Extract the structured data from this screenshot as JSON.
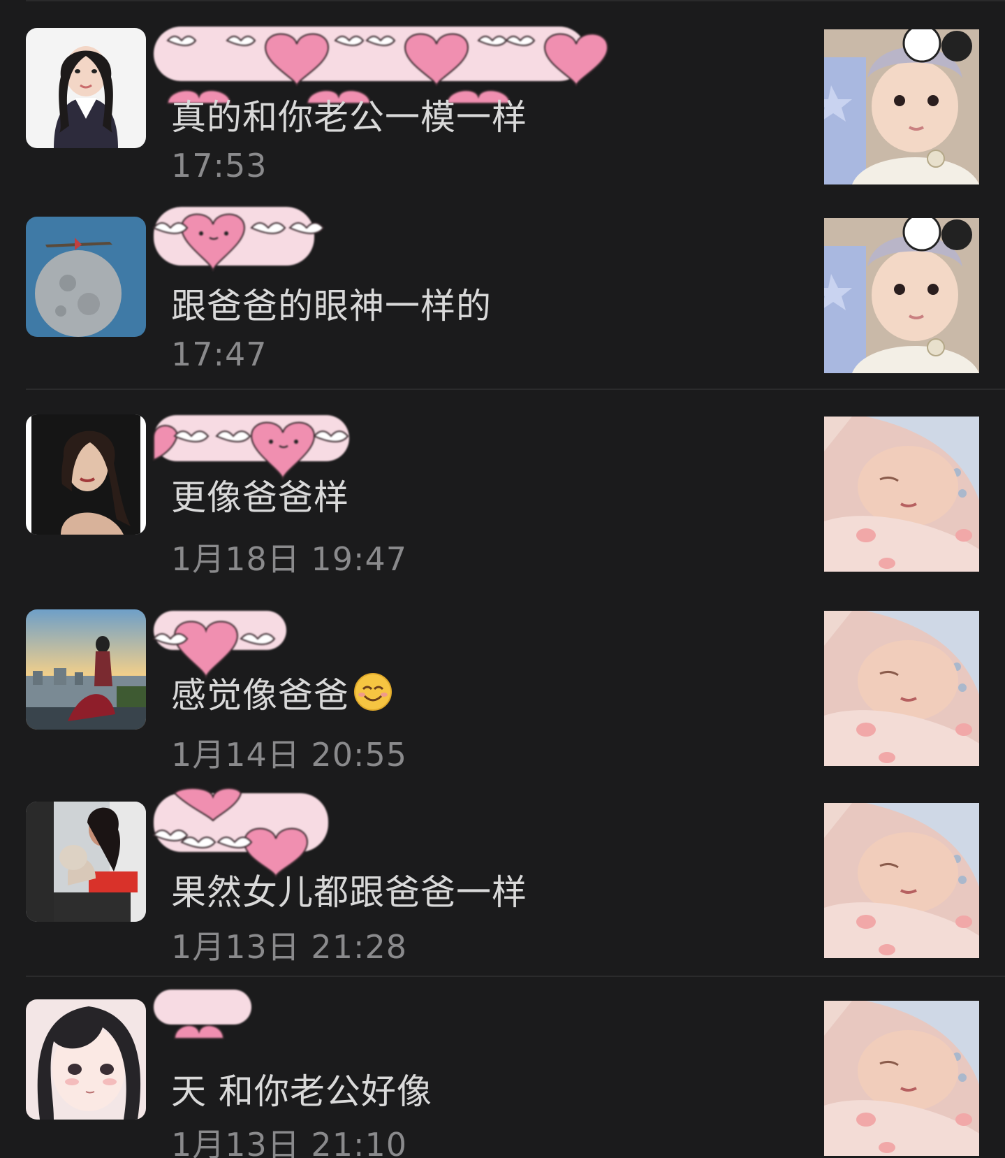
{
  "items": [
    {
      "comment": "真的和你老公一模一样",
      "time": "17:53",
      "avatar": "woman-portrait-avatar",
      "thumb": "baby-headband-photo"
    },
    {
      "comment": "跟爸爸的眼神一样的",
      "time": "17:47",
      "avatar": "moon-plane-avatar",
      "thumb": "baby-headband-photo"
    },
    {
      "comment": "更像爸爸样",
      "time": "1月18日 19:47",
      "avatar": "woman-dark-avatar",
      "thumb": "sleeping-baby-photo"
    },
    {
      "comment": "感觉像爸爸",
      "emoji": "smile-emoji",
      "time": "1月14日 20:55",
      "avatar": "city-sunset-avatar",
      "thumb": "sleeping-baby-photo"
    },
    {
      "comment": "果然女儿都跟爸爸一样",
      "time": "1月13日 21:28",
      "avatar": "woman-cat-avatar",
      "thumb": "sleeping-baby-photo"
    },
    {
      "comment": "天  和你老公好像",
      "time": "1月13日 21:10",
      "avatar": "anime-girl-avatar",
      "thumb": "sleeping-baby-photo"
    }
  ],
  "colors": {
    "background": "#1b1b1c",
    "comment_text": "#d9d9d9",
    "time_text": "#8a8a8c",
    "name_mask_pink": "#f7dbe3",
    "heart_pink": "#f08fb0"
  }
}
